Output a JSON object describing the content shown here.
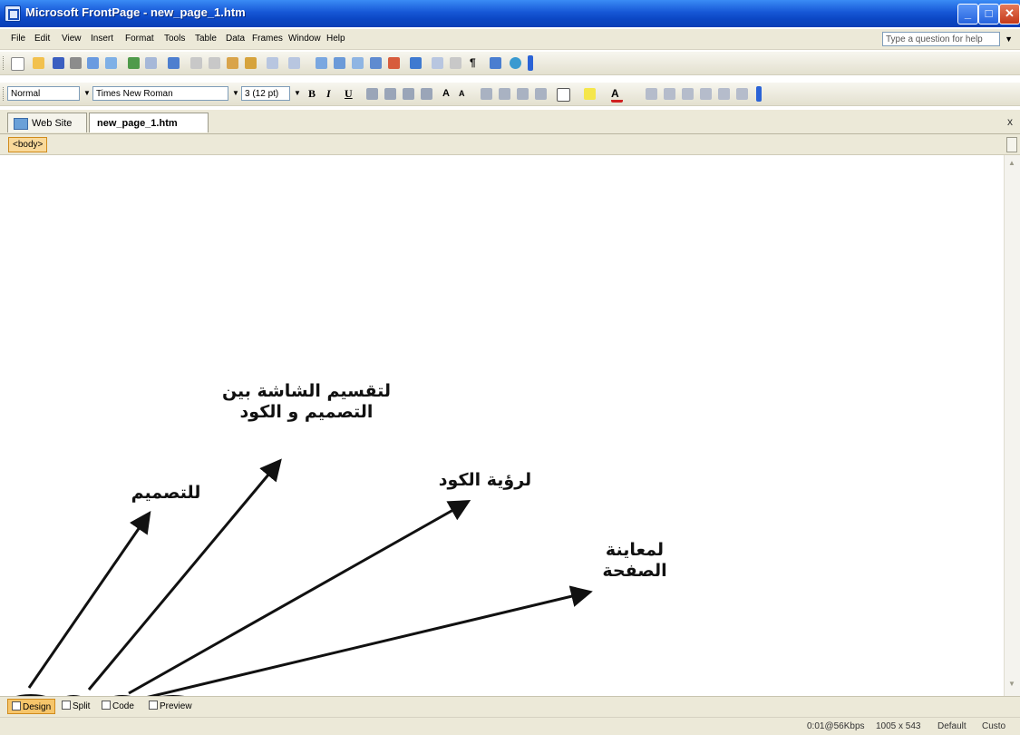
{
  "window": {
    "title": "Microsoft FrontPage - new_page_1.htm",
    "buttons": {
      "minimize": "_",
      "maximize": "□",
      "close": "✕"
    }
  },
  "menu": {
    "items": [
      "File",
      "Edit",
      "View",
      "Insert",
      "Format",
      "Tools",
      "Table",
      "Data",
      "Frames",
      "Window",
      "Help"
    ],
    "help_placeholder": "Type a question for help"
  },
  "formatting": {
    "style": "Normal",
    "font": "Times New Roman",
    "size": "3 (12 pt)",
    "bold": "B",
    "italic": "I",
    "underline": "U"
  },
  "tabs": {
    "web_site": "Web Site",
    "page": "new_page_1.htm",
    "close": "x"
  },
  "tagbar": {
    "body_tag": "<body>"
  },
  "view_buttons": {
    "design": "Design",
    "split": "Split",
    "code": "Code",
    "preview": "Preview"
  },
  "annotations": {
    "design": "للتصميم",
    "split": "لتقسيم الشاشة بين التصميم و الكود",
    "code": "لرؤية الكود",
    "preview": "لمعاينة الصفحة"
  },
  "status": {
    "speed": "0:01@56Kbps",
    "dimensions": "1005 x 543",
    "mode": "Default",
    "custom": "Custo"
  },
  "colors": {
    "titlebar": "#0a48c6",
    "chrome": "#ece9d8",
    "active_view": "#f6c56a"
  }
}
